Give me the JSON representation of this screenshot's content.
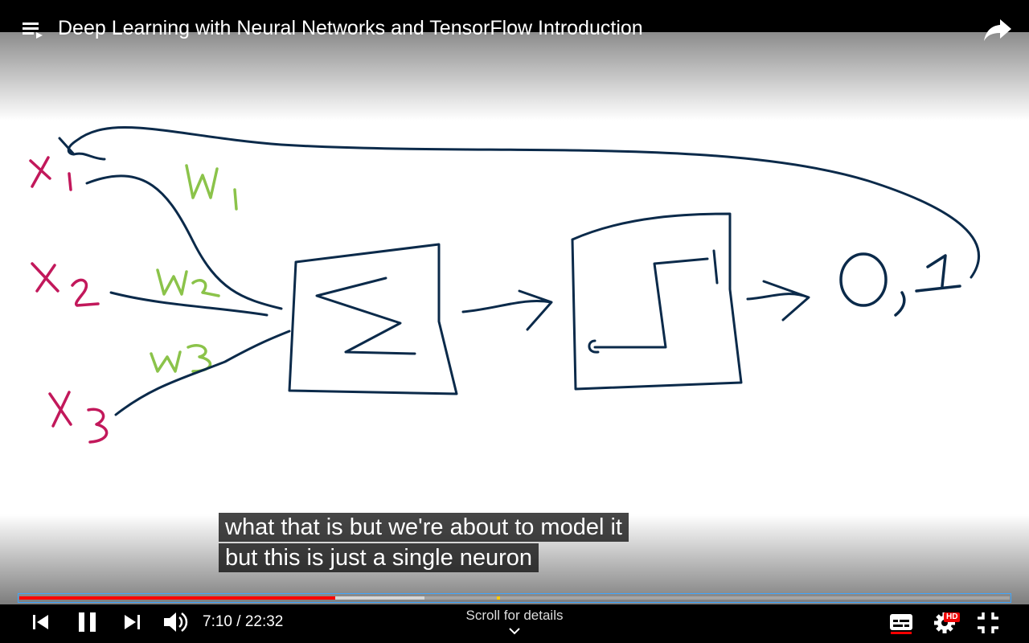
{
  "video": {
    "title": "Deep Learning with Neural Networks and TensorFlow Introduction"
  },
  "drawing": {
    "inputs": [
      "x1",
      "x2",
      "x3"
    ],
    "weights": [
      "W1",
      "W2",
      "W3"
    ],
    "summation_symbol": "Σ",
    "activation": "step-function",
    "output": "0,1",
    "colors": {
      "ink": "#0b2a4a",
      "input_color": "#c2185b",
      "weight_color": "#8bc34a"
    }
  },
  "captions": {
    "line1": "what that is but we're about to model it",
    "line2": "but this is just a single neuron"
  },
  "player": {
    "current_time": "7:10",
    "duration": "22:32",
    "time_display": "7:10 / 22:32",
    "played_fraction": 0.319,
    "buffered_fraction": 0.409,
    "scroll_hint": "Scroll for details",
    "quality_badge": "HD",
    "colors": {
      "played": "#ff0000",
      "accent": "#3ea6ff"
    },
    "icons": [
      "playlist-icon",
      "share-icon",
      "previous-icon",
      "pause-icon",
      "next-icon",
      "volume-icon",
      "subtitles-icon",
      "settings-icon",
      "exit-fullscreen-icon",
      "chevron-down-icon"
    ]
  }
}
